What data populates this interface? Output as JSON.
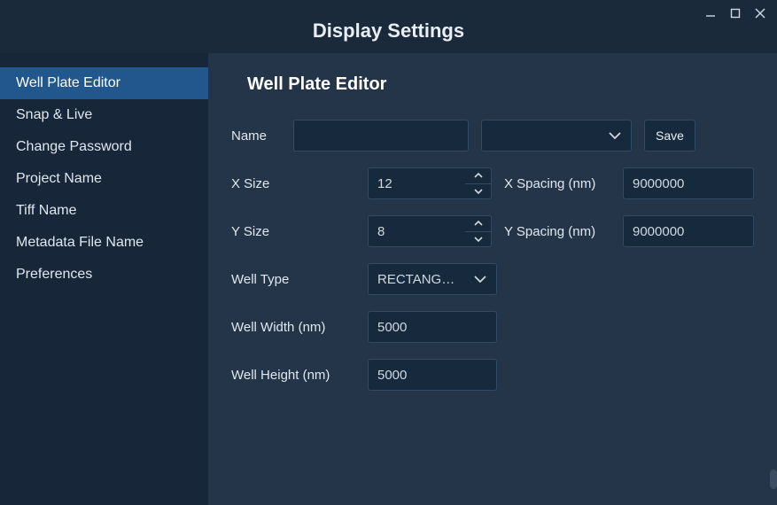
{
  "window": {
    "title": "Display Settings"
  },
  "sidebar": {
    "items": [
      {
        "label": "Well Plate Editor"
      },
      {
        "label": "Snap & Live"
      },
      {
        "label": "Change Password"
      },
      {
        "label": "Project Name"
      },
      {
        "label": "Tiff Name"
      },
      {
        "label": "Metadata File Name"
      },
      {
        "label": "Preferences"
      }
    ]
  },
  "panel": {
    "title": "Well Plate Editor",
    "name_label": "Name",
    "name_value": "",
    "preset_value": "",
    "save_label": "Save",
    "xsize_label": "X Size",
    "xsize_value": "12",
    "xspacing_label": "X Spacing (nm)",
    "xspacing_value": "9000000",
    "ysize_label": "Y Size",
    "ysize_value": "8",
    "yspacing_label": "Y Spacing (nm)",
    "yspacing_value": "9000000",
    "welltype_label": "Well Type",
    "welltype_value": "RECTANG…",
    "wellwidth_label": "Well Width (nm)",
    "wellwidth_value": "5000",
    "wellheight_label": "Well Height (nm)",
    "wellheight_value": "5000"
  }
}
